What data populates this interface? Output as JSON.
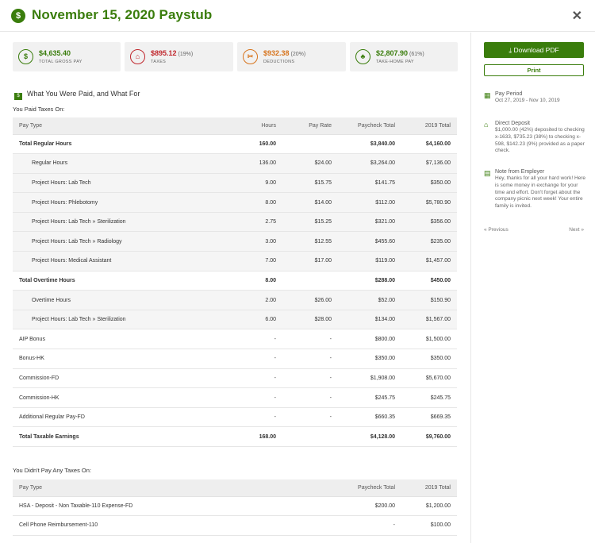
{
  "header": {
    "title": "November 15, 2020 Paystub",
    "logo_glyph": "$",
    "close_glyph": "✕"
  },
  "cards": [
    {
      "amount": "$4,635.40",
      "pct": "",
      "label": "TOTAL GROSS PAY",
      "color": "#3a7d0c",
      "glyph": "$"
    },
    {
      "amount": "$895.12",
      "pct": "(19%)",
      "label": "TAXES",
      "color": "#c0272d",
      "glyph": "⌂"
    },
    {
      "amount": "$932.38",
      "pct": "(20%)",
      "label": "DEDUCTIONS",
      "color": "#d7741d",
      "glyph": "✂"
    },
    {
      "amount": "$2,807.90",
      "pct": "(61%)",
      "label": "TAKE-HOME PAY",
      "color": "#3a7d0c",
      "glyph": "♣"
    }
  ],
  "section": {
    "title": "What You Were Paid, and What For",
    "glyph": "$"
  },
  "taxed": {
    "subtitle": "You Paid Taxes On:",
    "headers": [
      "Pay Type",
      "Hours",
      "Pay Rate",
      "Paycheck Total",
      "2019 Total"
    ],
    "rows": [
      [
        "Total Regular Hours",
        "160.00",
        "",
        "$3,840.00",
        "$4,160.00"
      ],
      [
        "Regular Hours",
        "136.00",
        "$24.00",
        "$3,264.00",
        "$7,136.00"
      ],
      [
        "Project Hours: Lab Tech",
        "9.00",
        "$15.75",
        "$141.75",
        "$350.00"
      ],
      [
        "Project Hours: Phlebotomy",
        "8.00",
        "$14.00",
        "$112.00",
        "$5,780.90"
      ],
      [
        "Project Hours: Lab Tech » Sterilization",
        "2.75",
        "$15.25",
        "$321.00",
        "$356.00"
      ],
      [
        "Project Hours: Lab Tech » Radiology",
        "3.00",
        "$12.55",
        "$455.60",
        "$235.00"
      ],
      [
        "Project Hours: Medical Assistant",
        "7.00",
        "$17.00",
        "$119.00",
        "$1,457.00"
      ],
      [
        "Total Overtime Hours",
        "8.00",
        "",
        "$288.00",
        "$450.00"
      ],
      [
        "Overtime Hours",
        "2.00",
        "$26.00",
        "$52.00",
        "$150.90"
      ],
      [
        "Project Hours: Lab Tech » Sterilization",
        "6.00",
        "$28.00",
        "$134.00",
        "$1,567.00"
      ],
      [
        "AIP Bonus",
        "-",
        "-",
        "$800.00",
        "$1,500.00"
      ],
      [
        "Bonus-HK",
        "-",
        "-",
        "$350.00",
        "$350.00"
      ],
      [
        "Commission-FD",
        "-",
        "-",
        "$1,908.00",
        "$5,670.00"
      ],
      [
        "Commission-HK",
        "-",
        "-",
        "$245.75",
        "$245.75"
      ],
      [
        "Additional Regular Pay-FD",
        "-",
        "-",
        "$660.35",
        "$669.35"
      ],
      [
        "Total Taxable Earnings",
        "168.00",
        "",
        "$4,128.00",
        "$9,760.00"
      ]
    ]
  },
  "untaxed": {
    "subtitle": "You Didn't Pay Any Taxes On:",
    "headers": [
      "Pay Type",
      "Paycheck Total",
      "2019 Total"
    ],
    "rows": [
      [
        "HSA - Deposit - Non Taxable-110 Expense-FD",
        "$200.00",
        "$1,200.00"
      ],
      [
        "Cell Phone Reimbursement-110",
        "-",
        "$100.00"
      ]
    ]
  },
  "sidebar": {
    "download_label": "Download PDF",
    "download_glyph": "⤓",
    "print_label": "Print",
    "pay_period": {
      "title": "Pay Period",
      "text": "Oct 27, 2019 - Nov 10, 2019",
      "icon": "calendar-icon"
    },
    "direct_deposit": {
      "title": "Direct Deposit",
      "text": "$1,000.00 (42%) deposited to checking x-1633, $735.23 (38%) to checking x-598, $142.23 (9%) provided as a paper check.",
      "icon": "bank-icon"
    },
    "note": {
      "title": "Note from Employer",
      "text": "Hey, thanks for all your hard work! Here is some money in exchange for your time and effort. Don't forget about the company picnic next week! Your entire family is invited.",
      "icon": "note-icon"
    },
    "prev_label": "« Previous",
    "next_label": "Next »"
  }
}
